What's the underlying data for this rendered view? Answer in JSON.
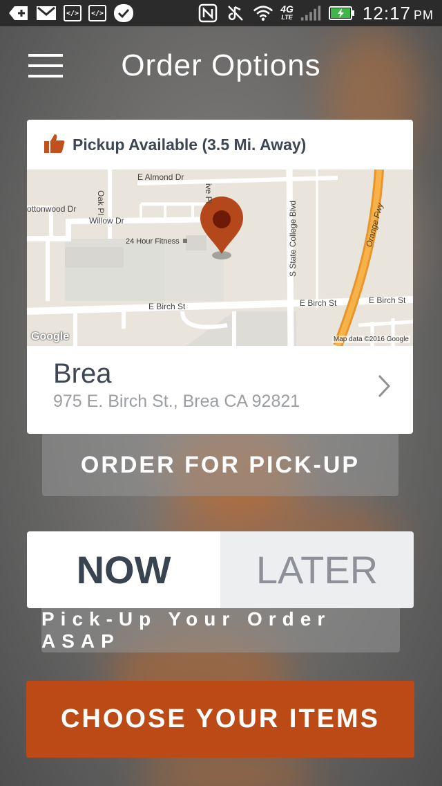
{
  "status_bar": {
    "time": "12:17",
    "ampm": "PM",
    "network": "4G",
    "network_sub": "LTE",
    "icons": [
      "add-icon",
      "gmail-icon",
      "code-icon",
      "code-icon",
      "check-icon",
      "nfc-icon",
      "mute-icon",
      "wifi-icon",
      "signal-icon",
      "battery-charging-icon"
    ]
  },
  "header": {
    "title": "Order Options",
    "menu_icon": "hamburger-menu-icon"
  },
  "location_card": {
    "pickup_text": "Pickup Available (3.5 Mi. Away)",
    "pickup_icon": "thumbs-up-icon",
    "store_name": "Brea",
    "address": "975 E. Birch St., Brea CA 92821"
  },
  "map": {
    "streets": [
      "E Almond Dr",
      "ottonwood Dr",
      "Willow Dr",
      "Oak Pl",
      "ive Pl",
      "24 Hour Fitness",
      "S State College Blvd",
      "Orange Fwy",
      "E Birch St",
      "E Birch St",
      "E Birch St"
    ],
    "google_logo": "Google",
    "attribution": "Map data ©2016 Google"
  },
  "order_pickup_label": "ORDER FOR PICK-UP",
  "time_toggle": {
    "now": "NOW",
    "later": "LATER",
    "selected": "NOW"
  },
  "asap_text": "Pick-Up Your Order ASAP",
  "cta_label": "CHOOSE YOUR ITEMS",
  "colors": {
    "accent": "#bb4a16",
    "pin": "#b5481a",
    "text_dark": "#3d4652",
    "freeway": "#f39c2c"
  }
}
